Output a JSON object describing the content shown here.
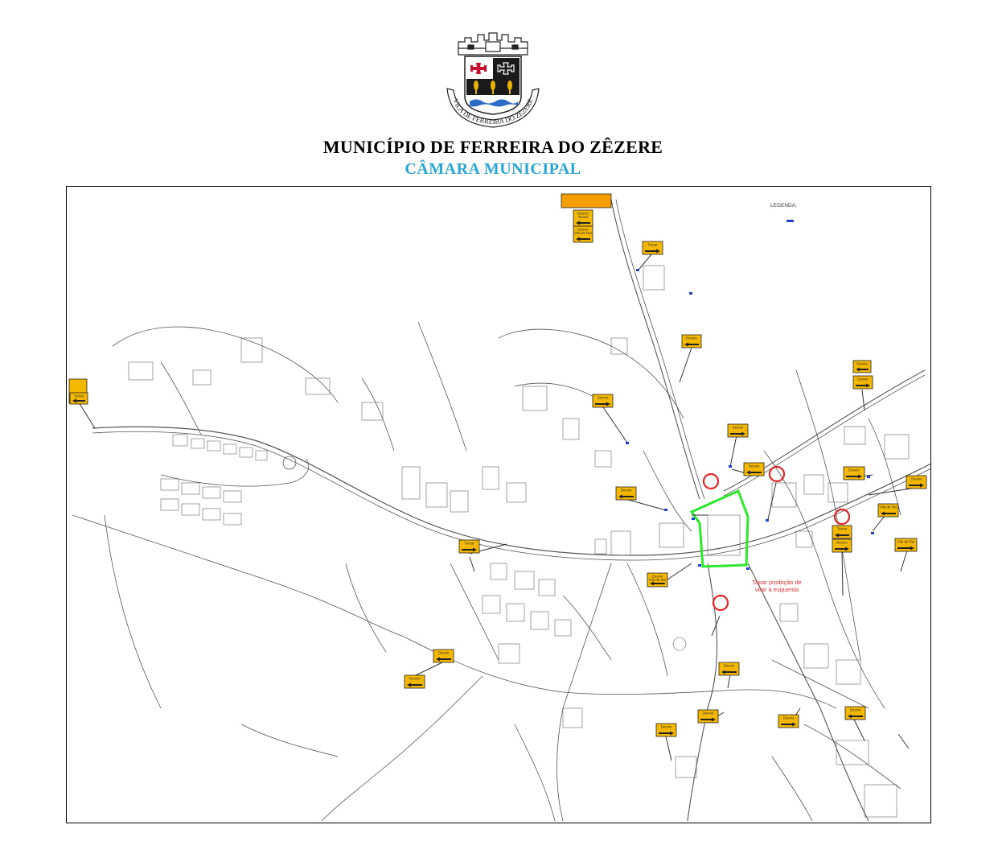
{
  "header": {
    "municipality": "MUNICÍPIO DE FERREIRA DO ZÊZERE",
    "chamber": "CÂMARA MUNICIPAL",
    "crest_motto": "VILA DE FERREIRA DO ZÊZERE"
  },
  "map": {
    "legend_title": "LEGENDA:",
    "legend_item": "",
    "restriction_note_line1": "Tapar proibição de",
    "restriction_note_line2": "virar à esquerda",
    "top_note": "",
    "colors": {
      "detour_sign": "#f5b800",
      "closed_perimeter": "#2ee82e",
      "no_entry_circle": "#e02828",
      "legend_marker": "#1f3fcc",
      "note_red": "#e53030",
      "chamber_text": "#29a6d6"
    },
    "signs": [
      {
        "l1": "",
        "l2": "",
        "dir": "left"
      },
      {
        "l1": "Desvio",
        "l2": "Tomar",
        "dir": "left"
      },
      {
        "l1": "Desvio",
        "l2": "Vila de Rei",
        "dir": "left"
      },
      {
        "l1": "Tomar",
        "l2": "",
        "dir": "right"
      },
      {
        "l1": "Desvio",
        "l2": "",
        "dir": "left"
      },
      {
        "l1": "Tomar",
        "l2": "",
        "dir": "left"
      },
      {
        "l1": "Desvio",
        "l2": "",
        "dir": "right"
      },
      {
        "l1": "Desvio",
        "l2": "",
        "dir": "left"
      },
      {
        "l1": "Desvio",
        "l2": "",
        "dir": "right"
      },
      {
        "l1": "Desvio",
        "l2": "",
        "dir": "right"
      },
      {
        "l1": "Desvio",
        "l2": "",
        "dir": "left"
      },
      {
        "l1": "Desvio",
        "l2": "",
        "dir": "left"
      },
      {
        "l1": "Desvio",
        "l2": "",
        "dir": "right"
      },
      {
        "l1": "Desvio",
        "l2": "",
        "dir": "right"
      },
      {
        "l1": "Vila de Rei",
        "l2": "",
        "dir": "left"
      },
      {
        "l1": "Tomar",
        "l2": "",
        "dir": "left"
      },
      {
        "l1": "Vila de Rei",
        "l2": "",
        "dir": "right"
      },
      {
        "l1": "Tomar",
        "l2": "",
        "dir": "right"
      },
      {
        "l1": "Desvio",
        "l2": "Vila de Rei",
        "dir": "left"
      },
      {
        "l1": "Desvio",
        "l2": "",
        "dir": "right"
      },
      {
        "l1": "Desvio",
        "l2": "",
        "dir": "left"
      },
      {
        "l1": "Desvio",
        "l2": "",
        "dir": "left"
      },
      {
        "l1": "Desvio",
        "l2": "",
        "dir": "left"
      },
      {
        "l1": "Desvio",
        "l2": "",
        "dir": "right"
      },
      {
        "l1": "Desvio",
        "l2": "",
        "dir": "right"
      },
      {
        "l1": "Desvio",
        "l2": "",
        "dir": "right"
      },
      {
        "l1": "Desvio",
        "l2": "",
        "dir": "left"
      }
    ]
  }
}
